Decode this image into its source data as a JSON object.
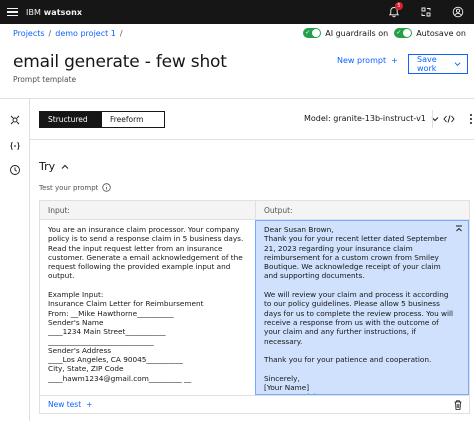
{
  "app": {
    "brand_prefix": "IBM",
    "brand_name": "watsonx",
    "notification_count": "5"
  },
  "breadcrumb": {
    "items": [
      "Projects",
      "demo project 1"
    ]
  },
  "toggles": [
    {
      "label": "AI guardrails on",
      "state": "on"
    },
    {
      "label": "Autosave on",
      "state": "on"
    }
  ],
  "header": {
    "title": "email generate - few shot",
    "subtitle": "Prompt template",
    "new_prompt_label": "New prompt",
    "save_work_label": "Save work"
  },
  "mode": {
    "options": [
      "Structured",
      "Freeform"
    ],
    "selected": "Structured"
  },
  "model": {
    "label": "Model: granite-13b-instruct-v1"
  },
  "try": {
    "heading": "Try",
    "test_label": "Test your prompt",
    "input_header": "Input:",
    "output_header": "Output:",
    "input_text": "You are an insurance claim processor. Your company policy is to send a response claim in 5 business days. Read the input request letter from an insurance customer. Generate a email acknowledgement of the request following the provided example input and output.\n\nExample Input:\nInsurance Claim Letter for Reimbursement\nFrom: __Mike Hawthorne__________\nSender's Name\n____1234 Main Street___________\n_____________________________\nSender's Address\n____Los Angeles, CA 90045__________\nCity, State, ZIP Code\n____hawm1234@gmail.com_________ __",
    "output_text": "Dear Susan Brown,\nThank you for your recent letter dated September 21, 2023 regarding your insurance claim reimbursement for a custom crown from Smiley Boutique. We acknowledge receipt of your claim and supporting documents.\n\nWe will review your claim and process it according to our policy guidelines. Please allow 5 business days for us to complete the review process. You will receive a response from us with the outcome of your claim and any further instructions, if necessary.\n\nThank you for your patience and cooperation.\n\nSincerely,\n[Your Name]\nInsurance Claim Processor",
    "new_test_label": "New test"
  },
  "colors": {
    "accent": "#0f62fe",
    "topbar": "#161616",
    "toggle_on": "#24a148",
    "output_bg": "#cfe1fd"
  }
}
